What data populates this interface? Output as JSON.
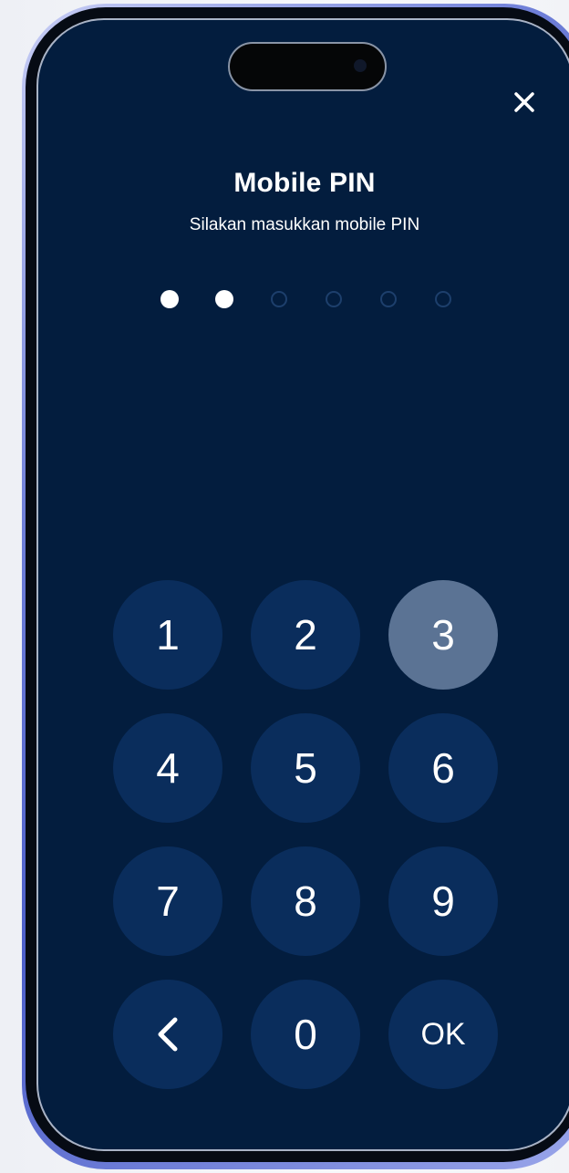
{
  "screen": {
    "title": "Mobile PIN",
    "subtitle": "Silakan masukkan mobile PIN",
    "close_icon": "close-icon"
  },
  "pin": {
    "length": 6,
    "entered": 2
  },
  "keypad": {
    "keys": [
      {
        "label": "1",
        "pressed": false
      },
      {
        "label": "2",
        "pressed": false
      },
      {
        "label": "3",
        "pressed": true
      },
      {
        "label": "4",
        "pressed": false
      },
      {
        "label": "5",
        "pressed": false
      },
      {
        "label": "6",
        "pressed": false
      },
      {
        "label": "7",
        "pressed": false
      },
      {
        "label": "8",
        "pressed": false
      },
      {
        "label": "9",
        "pressed": false
      },
      {
        "label": "",
        "icon": "chevron-left-icon",
        "pressed": false
      },
      {
        "label": "0",
        "pressed": false
      },
      {
        "label": "OK",
        "pressed": false
      }
    ]
  },
  "colors": {
    "screen_background": "#031d3e",
    "key_background": "#0a2d5c",
    "key_pressed": "#5b7394",
    "frame_accent": "#4d5fc9"
  }
}
